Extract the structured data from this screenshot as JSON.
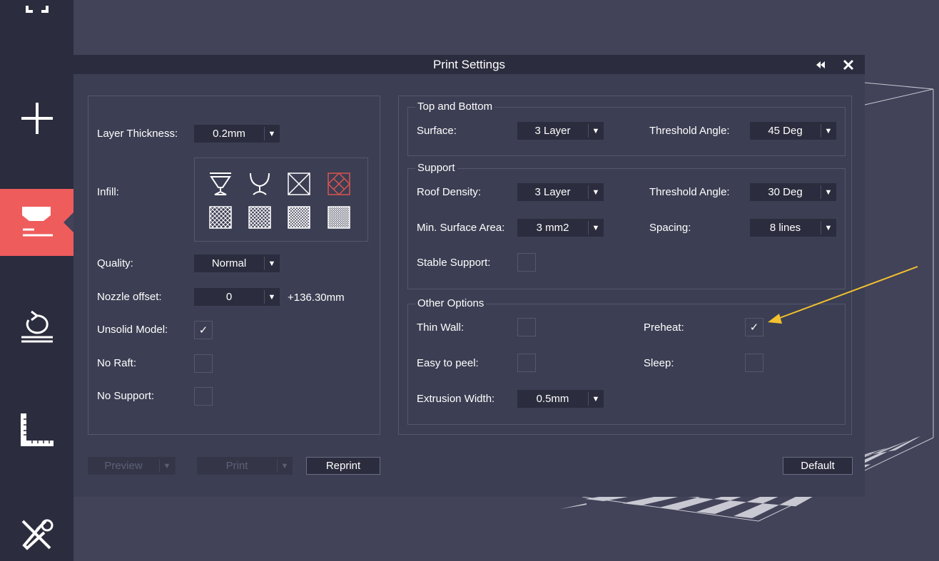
{
  "dialog": {
    "title": "Print Settings",
    "collapse_icon": "rewind-icon",
    "close_icon": "close-icon"
  },
  "sidebar": {
    "items": [
      {
        "name": "top-partial-icon"
      },
      {
        "name": "add-icon"
      },
      {
        "name": "print-settings-icon",
        "active": true
      },
      {
        "name": "rotate-icon"
      },
      {
        "name": "ruler-icon"
      },
      {
        "name": "tools-icon"
      }
    ],
    "accent_color": "#ef5c5c"
  },
  "left": {
    "layer_thickness": {
      "label": "Layer Thickness:",
      "value": "0.2mm"
    },
    "infill": {
      "label": "Infill:",
      "icons": [
        "hollow-cup-icon",
        "open-cup-icon",
        "cross-box-icon",
        "diamond-box-icon",
        "grid-fill-1-icon",
        "grid-fill-2-icon",
        "grid-fill-3-icon",
        "grid-fill-4-icon"
      ],
      "selected_index": 3,
      "selected_color": "#d9534f"
    },
    "quality": {
      "label": "Quality:",
      "value": "Normal"
    },
    "nozzle_offset": {
      "label": "Nozzle offset:",
      "value": "0",
      "extra": "+136.30mm"
    },
    "unsolid_model": {
      "label": "Unsolid Model:",
      "checked": true,
      "mark": "✓"
    },
    "no_raft": {
      "label": "No Raft:",
      "checked": false
    },
    "no_support": {
      "label": "No Support:",
      "checked": false
    }
  },
  "top_bottom": {
    "title": "Top and Bottom",
    "surface": {
      "label": "Surface:",
      "value": "3 Layer"
    },
    "threshold_angle": {
      "label": "Threshold Angle:",
      "value": "45 Deg"
    }
  },
  "support": {
    "title": "Support",
    "roof_density": {
      "label": "Roof Density:",
      "value": "3 Layer"
    },
    "threshold_angle": {
      "label": "Threshold Angle:",
      "value": "30 Deg"
    },
    "min_surface_area": {
      "label": "Min. Surface Area:",
      "value": "3 mm2"
    },
    "spacing": {
      "label": "Spacing:",
      "value": "8 lines"
    },
    "stable_support": {
      "label": "Stable Support:",
      "checked": false
    }
  },
  "other": {
    "title": "Other Options",
    "thin_wall": {
      "label": "Thin Wall:",
      "checked": false
    },
    "preheat": {
      "label": "Preheat:",
      "checked": true,
      "mark": "✓"
    },
    "easy_to_peel": {
      "label": "Easy to peel:",
      "checked": false
    },
    "sleep": {
      "label": "Sleep:",
      "checked": false
    },
    "extrusion_width": {
      "label": "Extrusion Width:",
      "value": "0.5mm"
    }
  },
  "footer": {
    "preview": "Preview",
    "print": "Print",
    "reprint": "Reprint",
    "default": "Default"
  },
  "dropdown_arrow": "▼",
  "annotation_color": "#f2c12e"
}
